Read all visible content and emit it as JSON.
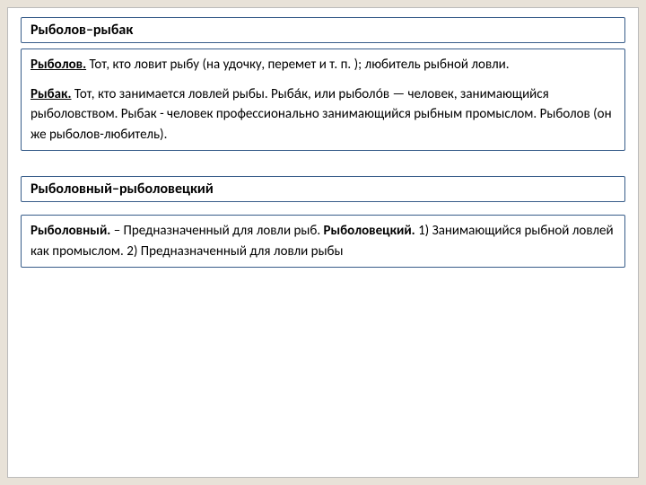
{
  "section1": {
    "title": "Рыболов–рыбак",
    "p1_term": "Рыболов.",
    "p1_text": " Тот, кто ловит рыбу (на удочку, перемет и т. п. ); любитель рыбной ловли.",
    "p2_term": "Рыбак.",
    "p2_text": "  Тот, кто занимается ловлей рыбы. Рыба́к, или рыболо́в — человек, занимающийся рыболовством. Рыбак - человек профессионально занимающийся рыбным промыслом. Рыболов (он же рыболов-любитель)."
  },
  "section2": {
    "title": "Рыболовный–рыболовецкий",
    "p1_b1": "Рыболовный.",
    "p1_t1": " – Предназначенный для ловли рыб. ",
    "p1_b2": "Рыболовецкий.",
    "p1_t2": " 1) Занимающийся рыбной ловлей как промыслом. 2) Предназначенный для ловли рыбы"
  }
}
